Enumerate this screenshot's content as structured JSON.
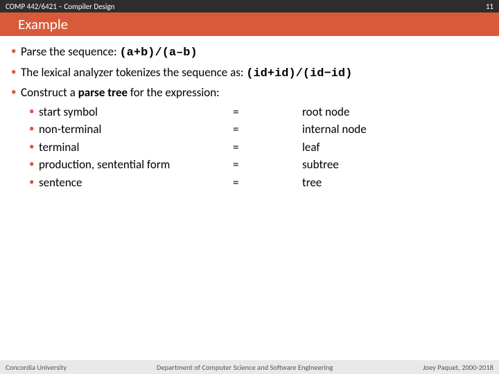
{
  "header": {
    "course": "COMP 442/6421 – Compiler Design",
    "page": "11"
  },
  "title": "Example",
  "bullets": {
    "l1_pre": "Parse the sequence: ",
    "l1_code": "(a+b)/(a–b)",
    "l2_pre": "The lexical analyzer tokenizes the sequence as: ",
    "l2_code": "(id+id)/(id−id)",
    "l3_pre": "Construct a ",
    "l3_bold": "parse tree",
    "l3_post": " for the expression:"
  },
  "map": [
    {
      "a": "start symbol",
      "b": "=",
      "c": "root node"
    },
    {
      "a": "non-terminal",
      "b": "=",
      "c": "internal node"
    },
    {
      "a": "terminal",
      "b": "=",
      "c": "leaf"
    },
    {
      "a": "production, sentential form",
      "b": "=",
      "c": "subtree"
    },
    {
      "a": "sentence",
      "b": "=",
      "c": "tree"
    }
  ],
  "footer": {
    "left": "Concordia University",
    "center": "Department of Computer Science and Software Engineering",
    "right": "Joey Paquet, 2000-2018"
  }
}
